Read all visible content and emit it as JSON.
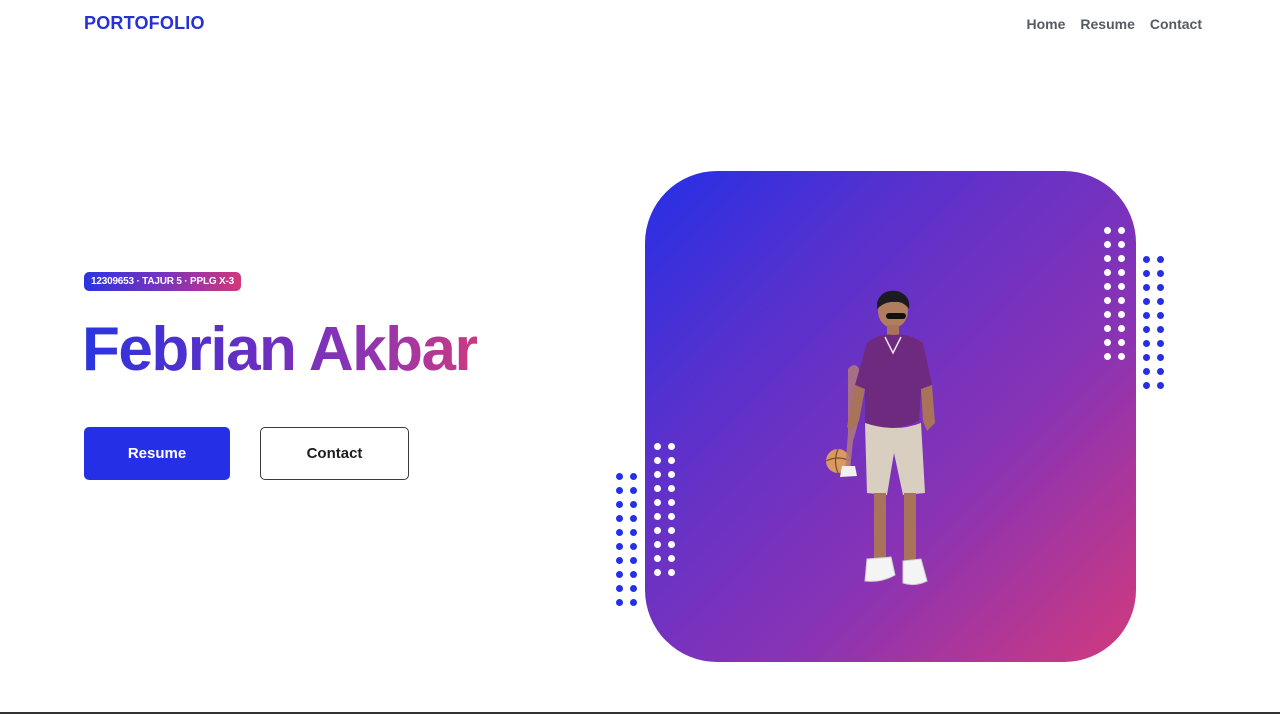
{
  "nav": {
    "brand": "PORTOFOLIO",
    "links": [
      "Home",
      "Resume",
      "Contact"
    ]
  },
  "hero": {
    "badge": "12309653 · TAJUR 5 · PPLG X-3",
    "name": "Febrian Akbar",
    "buttons": {
      "resume": "Resume",
      "contact": "Contact"
    }
  },
  "colors": {
    "accent": "#2530e6",
    "gradient_start": "#2530e6",
    "gradient_mid": "#8a33b4",
    "gradient_end": "#d23a7c"
  },
  "icons": {
    "portrait": "person-photo"
  }
}
